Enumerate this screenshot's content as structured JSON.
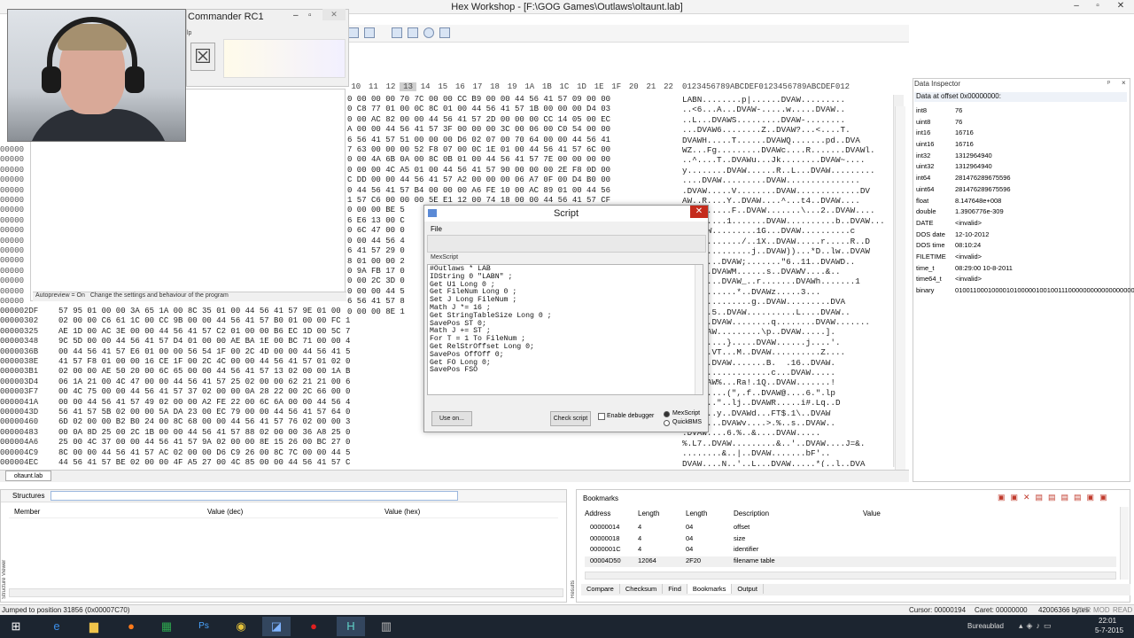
{
  "window": {
    "title": "Hex Workshop - [F:\\GOG Games\\Outlaws\\oltaunt.lab]"
  },
  "commander": {
    "title": "Commander RC1",
    "menu": "lp"
  },
  "hex_header": [
    "10",
    "11",
    "12",
    "13",
    "14",
    "15",
    "16",
    "17",
    "18",
    "19",
    "1A",
    "1B",
    "1C",
    "1D",
    "1E",
    "1F",
    "20",
    "21",
    "22"
  ],
  "ascii_header": "0123456789ABCDEF0123456789ABCDEF012",
  "hex_rows": [
    "0 00 00 00 70 7C 00 00 CC B9 00 00 44 56 41 57 09 00 00",
    "0 C8 77 01 00 0C 8C 01 00 44 56 41 57 1B 00 00 00 D4 03",
    "0 00 AC 82 00 00 44 56 41 57 2D 00 00 00 CC 14 05 00 EC",
    "A 00 00 44 56 41 57 3F 00 00 00 3C 00 06 00 C0 54 00 00",
    "6 56 41 57 51 00 00 00 D6 02 07 00 70 64 00 00 44 56 41",
    "7 63 00 00 00 52 F8 07 00 0C 1E 01 00 44 56 41 57 6C 00",
    "0 00 4A 6B 0A 00 8C 0B 01 00 44 56 41 57 7E 00 00 00 00",
    "0 00 00 4C A5 01 00 44 56 41 57 90 00 00 00 2E F8 0D 00",
    "C DD 00 00 44 56 41 57 A2 00 00 00 06 A7 0F 00 D4 B0 00",
    "0 44 56 41 57 B4 00 00 00 A6 FE 10 00 AC 89 01 00 44 56",
    "1 57 C6 00 00 00 5E E1 12 00 74 18 00 00 44 56 41 57 CF",
    "0 00 00 BE 5",
    "6 E6 13 00 C",
    "0 6C 47 00 0",
    "0 00 44 56 4",
    "6 41 57 29 0",
    "8 01 00 00 2",
    "0 9A FB 17 0",
    "0 00 2C 3D 0",
    "0 00 00 44 5",
    "6 56 41 57 8",
    "0 00 00 8E 1"
  ],
  "ascii_rows": [
    "LABN........p|......DVAW.........",
    "..<6...A...DVAW-.....w.....DVAW..",
    "..L...DVAWS.........DVAW-........",
    "...DVAW6........Z..DVAW?...<....T.",
    "DVAWH.....T......DVAWQ.......pd..DVA",
    "WZ...Fg.........DVAWc....R.......DVAWl.",
    "..^....T..DVAWu...Jk........DVAW~....",
    "y........DVAW......R..L...DVAW.........",
    "....DVAW.........DVAW...............",
    ".DVAW.....V........DVAW.............DV",
    "AW..R....Y..DVAW....^...t4..DVAW....",
    "..........F..DVAW.......\\...2..DVAW....",
    "DVAW.....1.......DVAW..........b..DVAW...",
    "..DVAW.........1G...DVAW..........c",
    ".DVAW......./..1X..DVAW.....r.....R..D",
    "..............j..DVAW))...*D..lw..DVAW",
    "....z...DVAW;.......\"6..11..DVAWD..",
    "......DVAWM......s..DVAWV....&..",
    "........DVAW_..r.......DVAWh.......1",
    "AWq........*..DVAWz.....3...",
    "..............g..DVAW.........DVA",
    "W:e...5..DVAW..........L....DVAW..",
    "......DVAW........q........DVAW.......",
    "...DVAW.........\\p..DVAW.....].",
    "AW.......}.....DVAW......j....'.",
    "......VT...M..DVAW..........Z....",
    "..le..DVAW.......B.  .16..DVAW.",
    "..................c...DVAW.....",
    "G..DVAW%...Ra!.1Q..DVAW.......!",
    "DVAW7....(\",.f..DVAW@....6.\".lp",
    "WI.....\"..lj..DVAWR.....i#.Lq..D",
    "..Z.#..y..DVAWd...FT$.1\\..DVAW",
    ".$..h...DVAWv....>.%..s..DVAW..",
    ".DVAW....6.%..&....DVAW.....",
    "%.L7..DVAW.........&..'..DVAW....J=&.",
    "........&..|..DVAW.......bF'..",
    "DVAW....N..'..L...DVAW.....*(..l..DVA"
  ],
  "offsets": [
    "00000",
    "00000",
    "00000",
    "00000",
    "00000",
    "00000",
    "00000",
    "00000",
    "00000",
    "00000",
    "00000",
    "00000",
    "00000",
    "00000",
    "00000",
    "00000"
  ],
  "lower_offsets": [
    "000002DF",
    "00000302",
    "00000325",
    "00000348",
    "0000036B",
    "0000038E",
    "000003B1",
    "000003D4",
    "000003F7",
    "0000041A",
    "0000043D",
    "00000460",
    "00000483",
    "000004A6",
    "000004C9",
    "000004EC"
  ],
  "lower_hex": [
    "57 95 01 00 00 3A 65 1A 00 8C 35 01 00 44 56 41 57 9E 01 00",
    "02 00 00 C6 61 1C 00 CC 9B 00 00 44 56 41 57 B0 01 00 00 FC 1",
    "AE 1D 00 AC 3E 00 00 44 56 41 57 C2 01 00 00 B6 EC 1D 00 5C 7",
    "9C 5D 00 00 44 56 41 57 D4 01 00 00 AE BA 1E 00 BC 71 00 00 4",
    "00 44 56 41 57 E6 01 00 00 56 54 1F 00 2C 4D 00 00 44 56 41 5",
    "41 57 F8 01 00 00 16 CE 1F 00 2C 4C 00 00 44 56 41 57 01 02 0",
    "02 00 00 AE 50 20 00 6C 65 00 00 44 56 41 57 13 02 00 00 1A B",
    "06 1A 21 00 4C 47 00 00 44 56 41 57 25 02 00 00 62 21 21 00 6",
    "00 4C 75 00 00 44 56 41 57 37 02 00 00 0A 28 22 00 2C 66 00 0",
    "00 00 44 56 41 57 49 02 00 00 A2 FE 22 00 6C 6A 00 00 44 56 4",
    "56 41 57 5B 02 00 00 5A DA 23 00 EC 79 00 00 44 56 41 57 64 0",
    "6D 02 00 00 B2 B0 24 00 8C 68 00 00 44 56 41 57 76 02 00 00 3",
    "00 0A 8D 25 00 2C 1B 00 00 44 56 41 57 88 02 00 00 36 A8 25 0",
    "25 00 4C 37 00 00 44 56 41 57 9A 02 00 00 8E 15 26 00 BC 27 0",
    "8C 00 00 44 56 41 57 AC 02 00 00 D6 C9 26 00 8C 7C 00 00 44 5",
    "44 56 41 57 BE 02 00 00 4F A5 27 00 4C 85 00 00 44 56 41 57 C"
  ],
  "autopreview": {
    "left": "Autopreview = On",
    "right": "Change the settings and behaviour of the program"
  },
  "script": {
    "title": "Script",
    "close": "✕",
    "file_menu": "File",
    "label": "MexScript",
    "code": "#Outlaws * LAB\nIDString 0 \"LABN\" ;\nGet U1 Long 0 ;\nGet FileNum Long 0 ;\nSet J Long FileNum ;\nMath J *= 16 ;\nGet StringTableSize Long 0 ;\nSavePos ST 0;\nMath J += ST ;\nFor T = 1 To FileNum ;\nGet RelStrOffset Long 0;\nSavePos OffOff 0;\nGet FO Long 0;\nSavePos FSO",
    "use_on": "Use on...",
    "check": "Check script",
    "enable_debugger": "Enable debugger",
    "mex": "MexScript",
    "quickbms": "QuickBMS"
  },
  "inspector": {
    "title": "Data Inspector",
    "offset": "Data at offset 0x00000000:",
    "rows": [
      {
        "n": "int8",
        "v": "76"
      },
      {
        "n": "uint8",
        "v": "76"
      },
      {
        "n": "int16",
        "v": "16716"
      },
      {
        "n": "uint16",
        "v": "16716"
      },
      {
        "n": "int32",
        "v": "1312964940"
      },
      {
        "n": "uint32",
        "v": "1312964940"
      },
      {
        "n": "int64",
        "v": "281476289675596"
      },
      {
        "n": "uint64",
        "v": "281476289675596"
      },
      {
        "n": "float",
        "v": "8.147648e+008"
      },
      {
        "n": "double",
        "v": "1.3906776e-309"
      },
      {
        "n": "DATE",
        "v": "<invalid>"
      },
      {
        "n": "DOS date",
        "v": "12-10-2012"
      },
      {
        "n": "DOS time",
        "v": "08:10:24"
      },
      {
        "n": "FILETIME",
        "v": "<invalid>"
      },
      {
        "n": "time_t",
        "v": "08:29:00 10-8-2011"
      },
      {
        "n": "time64_t",
        "v": "<invalid>"
      },
      {
        "n": "binary",
        "v": "0100110001000010100000100100111000000000000000000"
      }
    ]
  },
  "doc_tab": "oltaunt.lab",
  "structures": {
    "title": "Structures",
    "col_member": "Member",
    "col_dec": "Value (dec)",
    "col_hex": "Value (hex)",
    "side": "Structure Viewer"
  },
  "bookmarks": {
    "title": "Bookmarks",
    "cols": [
      "Address",
      "Length",
      "Length",
      "Description",
      "Value"
    ],
    "rows": [
      {
        "a": "00000014",
        "l": "4",
        "h": "04",
        "d": "offset"
      },
      {
        "a": "00000018",
        "l": "4",
        "h": "04",
        "d": "size"
      },
      {
        "a": "0000001C",
        "l": "4",
        "h": "04",
        "d": "identifier"
      },
      {
        "a": "00004D50",
        "l": "12064",
        "h": "2F20",
        "d": "filename table"
      }
    ],
    "tabs": [
      "Compare",
      "Checksum",
      "Find",
      "Bookmarks",
      "Output"
    ],
    "side": "Results"
  },
  "status": {
    "left": "Jumped to position 31856 (0x00007C70)",
    "cursor": "Cursor: 00000194",
    "caret": "Caret: 00000000",
    "size": "42006366 bytes",
    "ovr": "OVR",
    "mod": "MOD",
    "read": "READ"
  },
  "taskbar": {
    "lang": "Bureaublad",
    "time": "22:01",
    "date": "5-7-2015"
  }
}
